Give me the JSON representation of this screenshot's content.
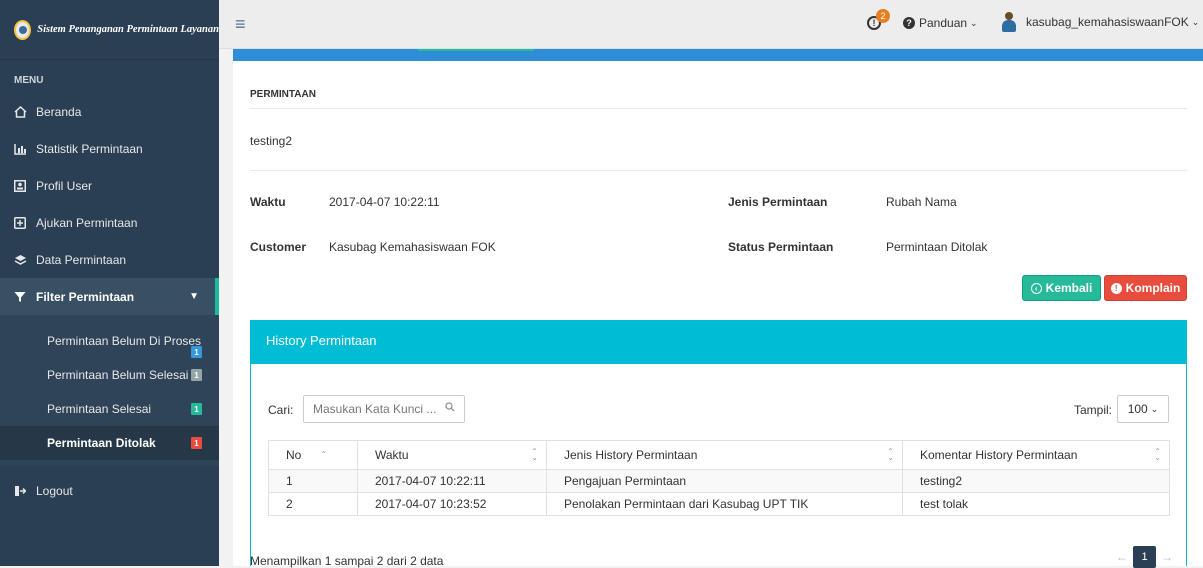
{
  "app": {
    "brand": "Sistem Penanganan Permintaan Layanan"
  },
  "sidebar": {
    "menu_title": "MENU",
    "items": [
      {
        "label": "Beranda",
        "icon": "home-icon"
      },
      {
        "label": "Statistik Permintaan",
        "icon": "bar-chart-icon"
      },
      {
        "label": "Profil User",
        "icon": "profile-card-icon"
      },
      {
        "label": "Ajukan Permintaan",
        "icon": "submit-request-icon"
      },
      {
        "label": "Data Permintaan",
        "icon": "layers-icon"
      },
      {
        "label": "Filter Permintaan",
        "icon": "filter-icon"
      },
      {
        "label": "Logout",
        "icon": "logout-icon"
      }
    ],
    "submenu": [
      {
        "label": "Permintaan Belum Di Proses",
        "badge": "1"
      },
      {
        "label": "Permintaan Belum Selesai",
        "badge": "1"
      },
      {
        "label": "Permintaan Selesai",
        "badge": "1"
      },
      {
        "label": "Permintaan Ditolak",
        "badge": "1"
      }
    ]
  },
  "topbar": {
    "notif_count": "2",
    "panduan": "Panduan",
    "username": "kasubag_kemahasiswaanFOK"
  },
  "detail": {
    "section_title": "PERMINTAAN",
    "description": "testing2",
    "waktu_label": "Waktu",
    "waktu_value": "2017-04-07 10:22:11",
    "customer_label": "Customer",
    "customer_value": "Kasubag Kemahasiswaan FOK",
    "jenis_label": "Jenis Permintaan",
    "jenis_value": "Rubah Nama",
    "status_label": "Status Permintaan",
    "status_value": "Permintaan Ditolak",
    "kembali_label": "Kembali",
    "komplain_label": "Komplain"
  },
  "history": {
    "title": "History Permintaan",
    "cari_label": "Cari:",
    "search_placeholder": "Masukan Kata Kunci ...",
    "tampil_label": "Tampil:",
    "tampil_value": "100",
    "columns": [
      "No",
      "Waktu",
      "Jenis History Permintaan",
      "Komentar History Permintaan"
    ],
    "rows": [
      [
        "1",
        "2017-04-07 10:22:11",
        "Pengajuan Permintaan",
        "testing2"
      ],
      [
        "2",
        "2017-04-07 10:23:52",
        "Penolakan Permintaan dari Kasubag UPT TIK",
        "test tolak"
      ]
    ],
    "footer": "Menampilkan 1 sampai 2 dari 2 data",
    "page": "1"
  },
  "colors": {
    "sidebar": "#2a3f54",
    "accent_cyan": "#00bcd4",
    "success": "#26b99a",
    "danger": "#e74c3c",
    "top_strip": "#2e8dd6"
  }
}
